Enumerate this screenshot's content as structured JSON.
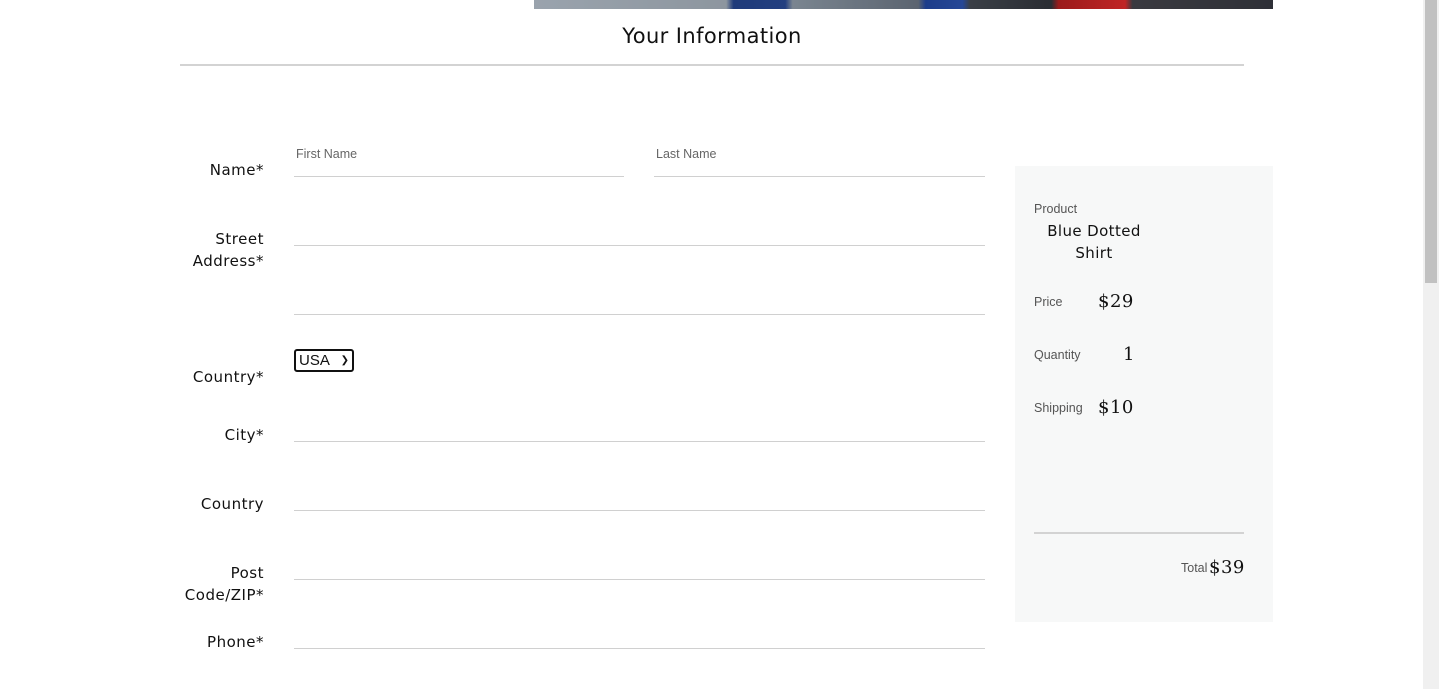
{
  "header": {
    "title": "Your Information"
  },
  "form": {
    "name_label": "Name*",
    "first_name_placeholder": "First Name",
    "last_name_placeholder": "Last Name",
    "street_label_line1": "Street",
    "street_label_line2": "Address*",
    "country_select_label": "Country*",
    "country_selected": "USA",
    "city_label": "City*",
    "country_label": "Country",
    "post_label_line1": "Post",
    "post_label_line2": "Code/ZIP*",
    "phone_label": "Phone*"
  },
  "summary": {
    "product_label": "Product",
    "product_value": "Blue Dotted Shirt",
    "price_label": "Price",
    "price_value": "$29",
    "quantity_label": "Quantity",
    "quantity_value": "1",
    "shipping_label": "Shipping",
    "shipping_value": "$10",
    "total_label": "Total",
    "total_value": "$39"
  },
  "colors": {
    "panel_bg": "#f7f8f8",
    "rule": "#d3d3d3",
    "text": "#111111"
  }
}
